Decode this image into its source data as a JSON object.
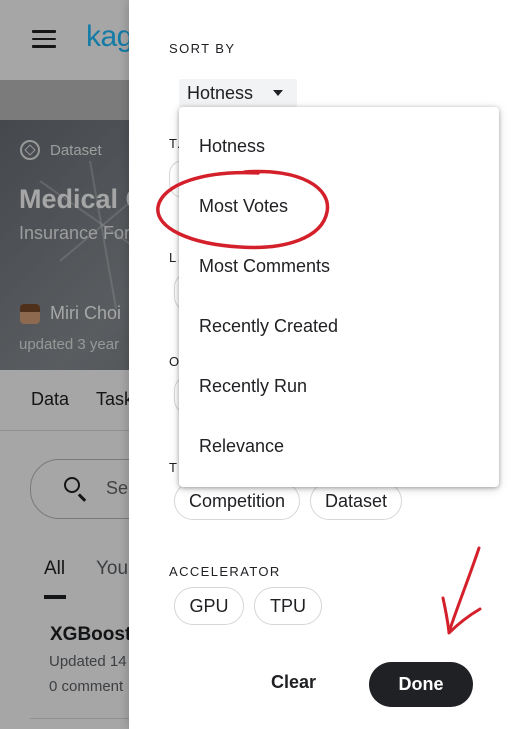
{
  "background": {
    "logo_text": "kag",
    "dataset_tag": "Dataset",
    "title": "Medical C",
    "subtitle": "Insurance For",
    "author": "Miri Choi",
    "updated": "updated 3 year",
    "tabs": [
      "Data",
      "Task"
    ],
    "search_placeholder": "Se",
    "filter_tabs": [
      "All",
      "You"
    ],
    "notebook_title": "XGBoost",
    "notebook_updated": "Updated 14",
    "notebook_comments": "0 comment"
  },
  "drawer": {
    "sort_by_label": "SORT BY",
    "sort_selected": "Hotness",
    "hidden_label_1": "T.",
    "hidden_label_2": "L.",
    "hidden_label_3": "O.",
    "hidden_label_4": "T",
    "type_chips": [
      "Competition",
      "Dataset"
    ],
    "accelerator_label": "ACCELERATOR",
    "accelerator_chips": [
      "GPU",
      "TPU"
    ],
    "clear_label": "Clear",
    "done_label": "Done"
  },
  "sort_menu": {
    "options": [
      "Hotness",
      "Most Votes",
      "Most Comments",
      "Recently Created",
      "Recently Run",
      "Relevance"
    ],
    "highlighted": "Most Votes"
  },
  "colors": {
    "brand": "#20beff",
    "annotation": "#d4202a",
    "done_button": "#202124"
  }
}
